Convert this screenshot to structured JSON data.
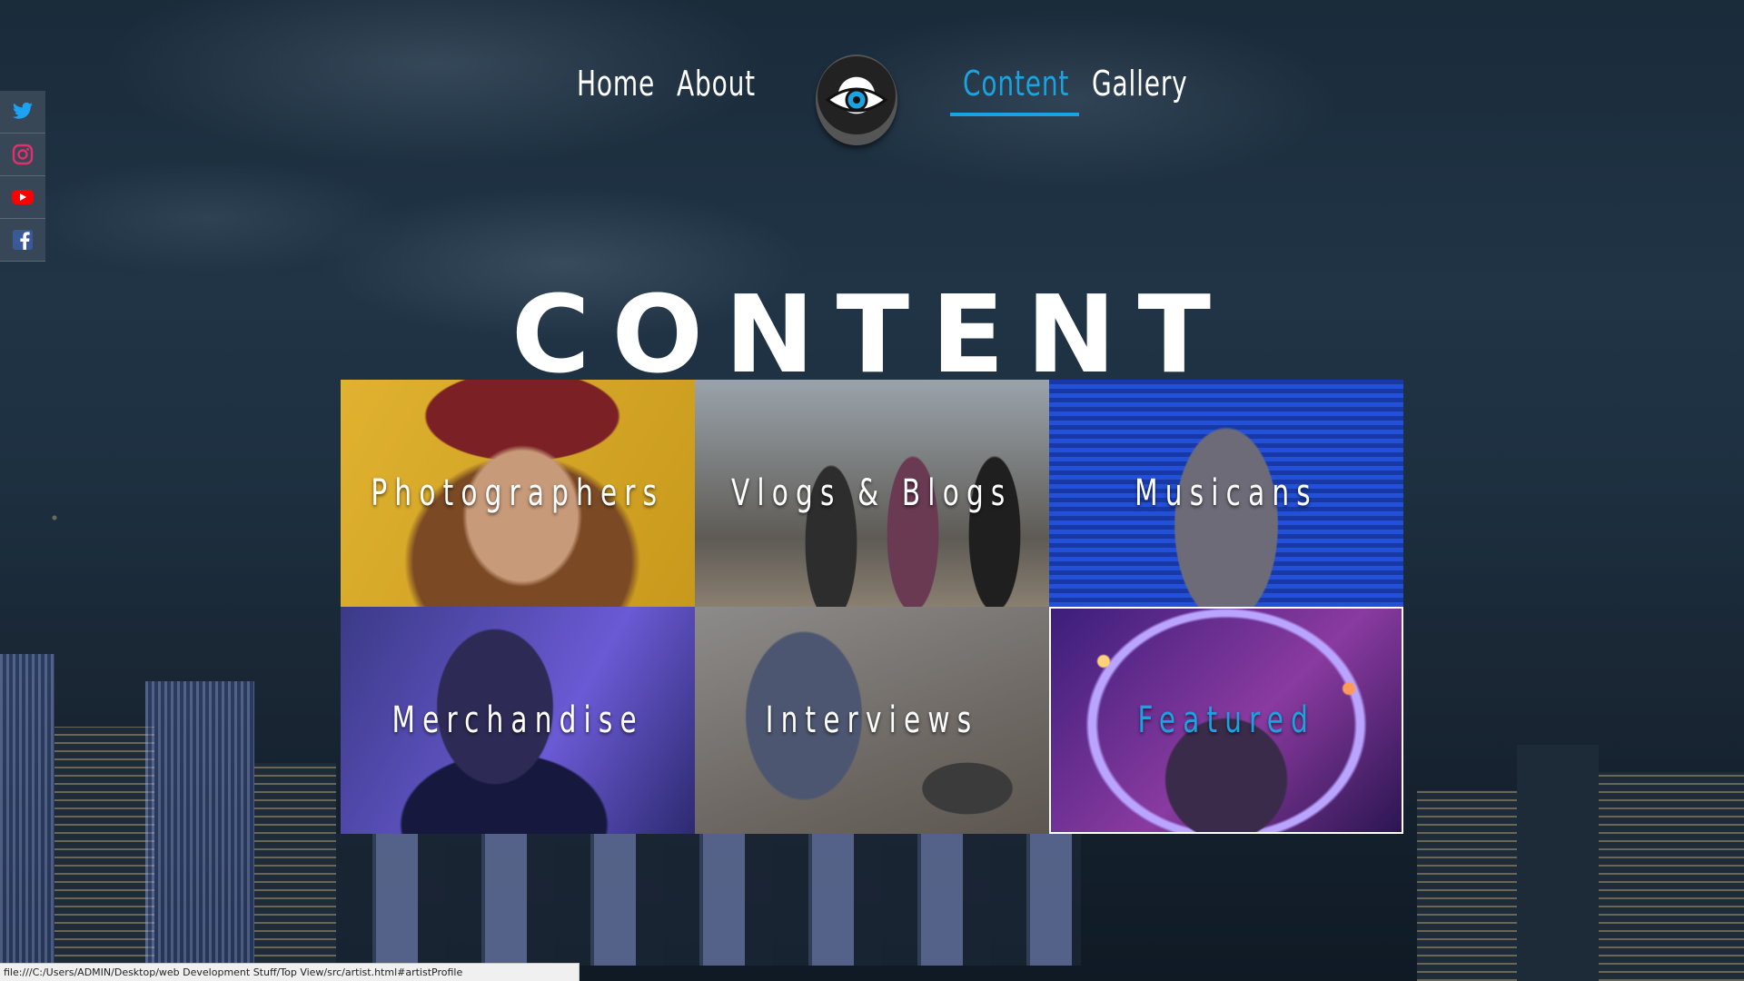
{
  "social": [
    {
      "name": "twitter-icon",
      "color": "#1da1f2"
    },
    {
      "name": "instagram-icon",
      "color": "#d6247a"
    },
    {
      "name": "youtube-icon",
      "color": "#ff0000"
    },
    {
      "name": "facebook-icon",
      "color": "#3b5998"
    }
  ],
  "nav": {
    "home": "Home",
    "about": "About",
    "content": "Content",
    "gallery": "Gallery",
    "active": "Content",
    "accent_color": "#1aa3e0"
  },
  "logo_icon": "eye-africa-logo-icon",
  "page_title": "CONTENT",
  "tiles": [
    {
      "label": "Photographers"
    },
    {
      "label": "Vlogs & Blogs"
    },
    {
      "label": "Musicans"
    },
    {
      "label": "Merchandise"
    },
    {
      "label": "Interviews"
    },
    {
      "label": "Featured",
      "hovered": true
    }
  ],
  "status_url": "file:///C:/Users/ADMIN/Desktop/web Development Stuff/Top View/src/artist.html#artistProfile"
}
